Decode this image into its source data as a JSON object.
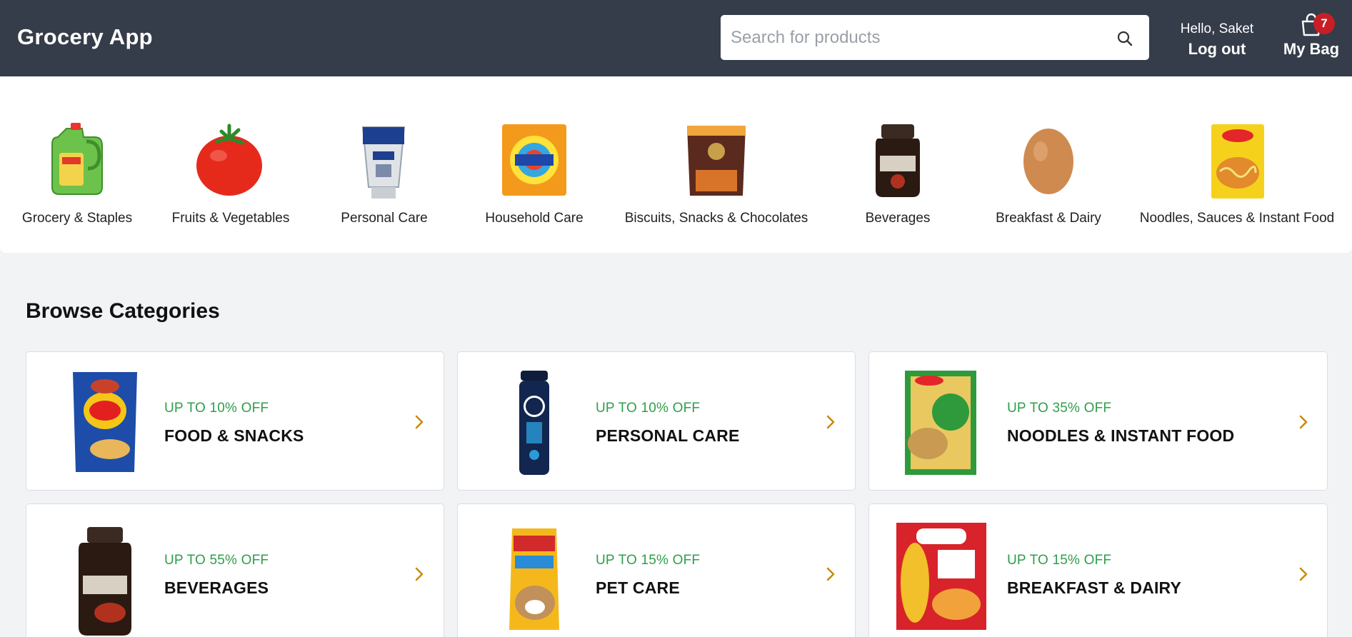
{
  "header": {
    "brand": "Grocery App",
    "search_placeholder": "Search for products",
    "greeting": "Hello, Saket",
    "logout_label": "Log out",
    "bag_label": "My Bag",
    "bag_count": "7"
  },
  "strip": {
    "items": [
      {
        "label": "Grocery & Staples",
        "icon": "oil-can-icon"
      },
      {
        "label": "Fruits & Vegetables",
        "icon": "tomato-icon"
      },
      {
        "label": "Personal Care",
        "icon": "cream-tube-icon"
      },
      {
        "label": "Household Care",
        "icon": "detergent-pack-icon"
      },
      {
        "label": "Biscuits, Snacks & Chocolates",
        "icon": "chips-pack-icon"
      },
      {
        "label": "Beverages",
        "icon": "coffee-jar-icon"
      },
      {
        "label": "Breakfast & Dairy",
        "icon": "egg-icon"
      },
      {
        "label": "Noodles, Sauces & Instant Food",
        "icon": "noodles-pack-icon"
      }
    ]
  },
  "browse": {
    "title": "Browse Categories",
    "cards": [
      {
        "offer": "UP TO 10% OFF",
        "title": "FOOD & SNACKS",
        "icon": "chips-bag-icon"
      },
      {
        "offer": "UP TO 10% OFF",
        "title": "PERSONAL CARE",
        "icon": "deodorant-can-icon"
      },
      {
        "offer": "UP TO 35% OFF",
        "title": "NOODLES & INSTANT FOOD",
        "icon": "noodles-pack-icon"
      },
      {
        "offer": "UP TO 55% OFF",
        "title": "BEVERAGES",
        "icon": "coffee-jar-icon"
      },
      {
        "offer": "UP TO 15% OFF",
        "title": "PET CARE",
        "icon": "dog-treat-pack-icon"
      },
      {
        "offer": "UP TO 15% OFF",
        "title": "BREAKFAST & DAIRY",
        "icon": "cereal-box-icon"
      }
    ]
  },
  "colors": {
    "header_bg": "#353c4a",
    "offer_green": "#2e9e49",
    "chevron_orange": "#c98a00",
    "badge_red": "#c81e26"
  }
}
